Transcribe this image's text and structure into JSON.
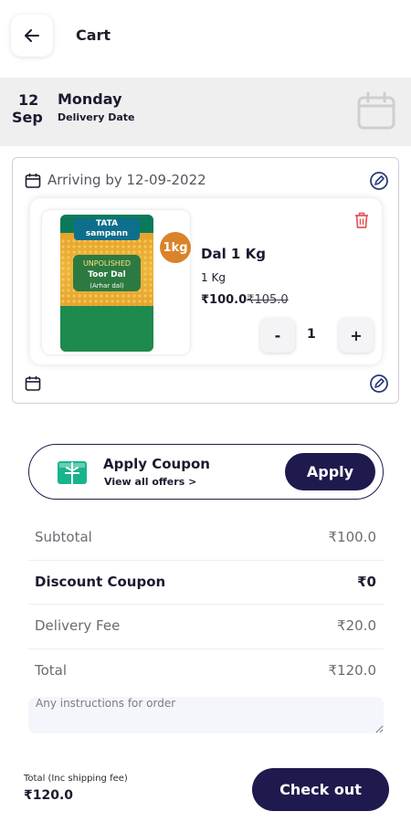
{
  "header": {
    "title": "Cart",
    "back_icon": "arrow-left-icon"
  },
  "delivery": {
    "day": "12",
    "month": "Sep",
    "weekday": "Monday",
    "caption": "Delivery Date",
    "calendar_icon": "calendar-icon"
  },
  "order": {
    "arriving_text": "Arriving by 12-09-2022",
    "item": {
      "name": "Dal 1 Kg",
      "weight": "1 Kg",
      "price": "₹100.0",
      "mrp": "₹105.0",
      "quantity": "1",
      "minus_label": "-",
      "plus_label": "+",
      "badge": "1kg",
      "pack_brand_line1": "TATA",
      "pack_brand_line2": "sampann",
      "pack_name_line1": "UNPOLISHED",
      "pack_name_line2": "Toor Dal",
      "pack_name_line3": "(Arhar dal)"
    }
  },
  "coupon": {
    "title": "Apply Coupon",
    "subtitle": "View all offers >",
    "button": "Apply",
    "icon": "coupon-ticket-icon"
  },
  "summary": {
    "rows": [
      {
        "label": "Subtotal",
        "value": "₹100.0",
        "emphasis": false
      },
      {
        "label": "Discount Coupon",
        "value": "₹0",
        "emphasis": true
      },
      {
        "label": "Delivery Fee",
        "value": "₹20.0",
        "emphasis": false
      },
      {
        "label": "Total",
        "value": "₹120.0",
        "emphasis": false
      }
    ],
    "instructions_placeholder": "Any instructions for order"
  },
  "footer": {
    "caption": "Total (Inc shipping fee)",
    "total": "₹120.0",
    "checkout": "Check out"
  },
  "colors": {
    "primary": "#1e1a4d",
    "accent_coupon": "#18b48c",
    "trash": "#e0575b",
    "edit": "#2a3a7a"
  }
}
